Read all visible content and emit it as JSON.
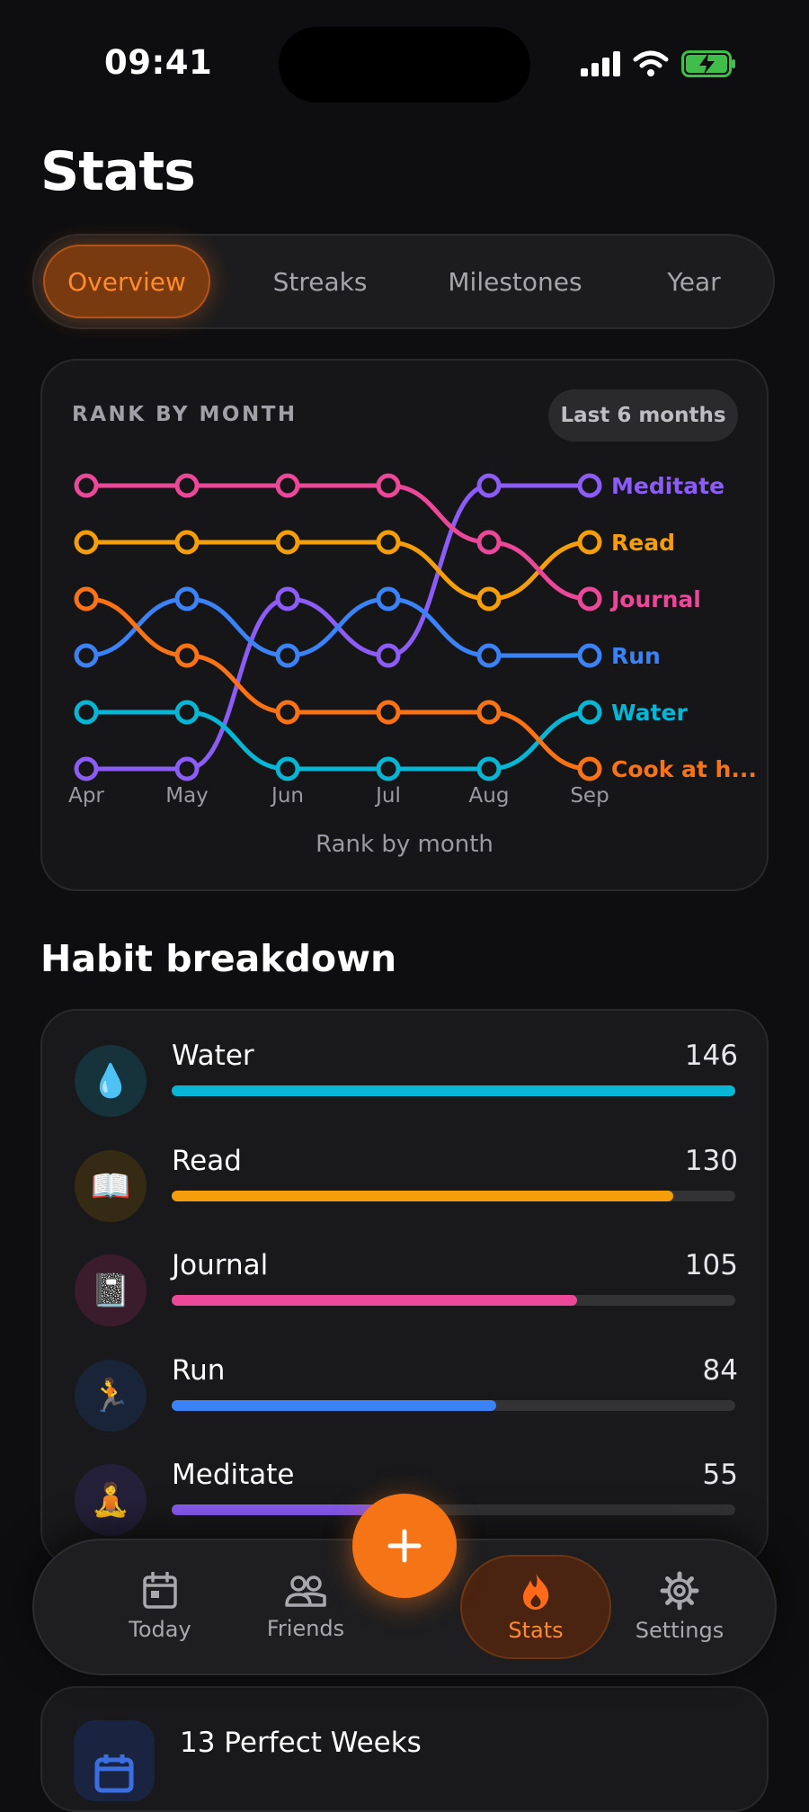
{
  "status_bar": {
    "time": "09:41"
  },
  "page": {
    "title": "Stats"
  },
  "tabs": [
    {
      "label": "Overview",
      "active": true
    },
    {
      "label": "Streaks",
      "active": false
    },
    {
      "label": "Milestones",
      "active": false
    },
    {
      "label": "Year",
      "active": false
    }
  ],
  "rank_card": {
    "label": "RANK BY MONTH",
    "range_chip": "Last 6 months",
    "caption": "Rank by month"
  },
  "chart_data": {
    "type": "line",
    "categories": [
      "Apr",
      "May",
      "Jun",
      "Jul",
      "Aug",
      "Sep"
    ],
    "y_meaning": "rank (1 = top)",
    "ylim": [
      6,
      1
    ],
    "grid": false,
    "legend": "end-of-line labels",
    "series": [
      {
        "name": "Meditate",
        "color": "#8b5cf6",
        "values": [
          6,
          6,
          3,
          4,
          1,
          1
        ]
      },
      {
        "name": "Read",
        "color": "#f59e0b",
        "values": [
          2,
          2,
          2,
          2,
          3,
          2
        ]
      },
      {
        "name": "Journal",
        "color": "#ec4899",
        "values": [
          1,
          1,
          1,
          1,
          2,
          3
        ]
      },
      {
        "name": "Run",
        "color": "#3b82f6",
        "values": [
          4,
          3,
          4,
          3,
          4,
          4
        ]
      },
      {
        "name": "Water",
        "color": "#06b6d4",
        "values": [
          5,
          5,
          6,
          6,
          6,
          5
        ]
      },
      {
        "name": "Cook at h...",
        "color": "#f97316",
        "values": [
          3,
          4,
          5,
          5,
          5,
          6
        ]
      }
    ]
  },
  "breakdown": {
    "title": "Habit breakdown",
    "max": 146,
    "items": [
      {
        "name": "Water",
        "count": "146",
        "value": 146,
        "icon": "💧",
        "icon_name": "water-drop-icon",
        "color": "#06b6d4",
        "icon_bg": "#16323a"
      },
      {
        "name": "Read",
        "count": "130",
        "value": 130,
        "icon": "📖",
        "icon_name": "book-icon",
        "color": "#f59e0b",
        "icon_bg": "#352a14"
      },
      {
        "name": "Journal",
        "count": "105",
        "value": 105,
        "icon": "📓",
        "icon_name": "notebook-icon",
        "color": "#ec4899",
        "icon_bg": "#3a1c2c"
      },
      {
        "name": "Run",
        "count": "84",
        "value": 84,
        "icon": "🏃",
        "icon_name": "runner-icon",
        "color": "#3b82f6",
        "icon_bg": "#1a2438"
      },
      {
        "name": "Meditate",
        "count": "55",
        "value": 55,
        "icon": "🧘",
        "icon_name": "meditation-icon",
        "color": "#8b5cf6",
        "icon_bg": "#25203a"
      }
    ]
  },
  "nav": {
    "items": [
      {
        "label": "Today",
        "icon": "calendar-icon",
        "active": false
      },
      {
        "label": "Friends",
        "icon": "people-icon",
        "active": false
      },
      {
        "label": "Stats",
        "icon": "flame-icon",
        "active": true
      },
      {
        "label": "Settings",
        "icon": "gear-icon",
        "active": false
      }
    ],
    "fab": "add-icon"
  },
  "perfect_weeks": {
    "text": "13 Perfect Weeks"
  },
  "colors": {
    "accent": "#f47416",
    "background": "#0e0e10"
  }
}
